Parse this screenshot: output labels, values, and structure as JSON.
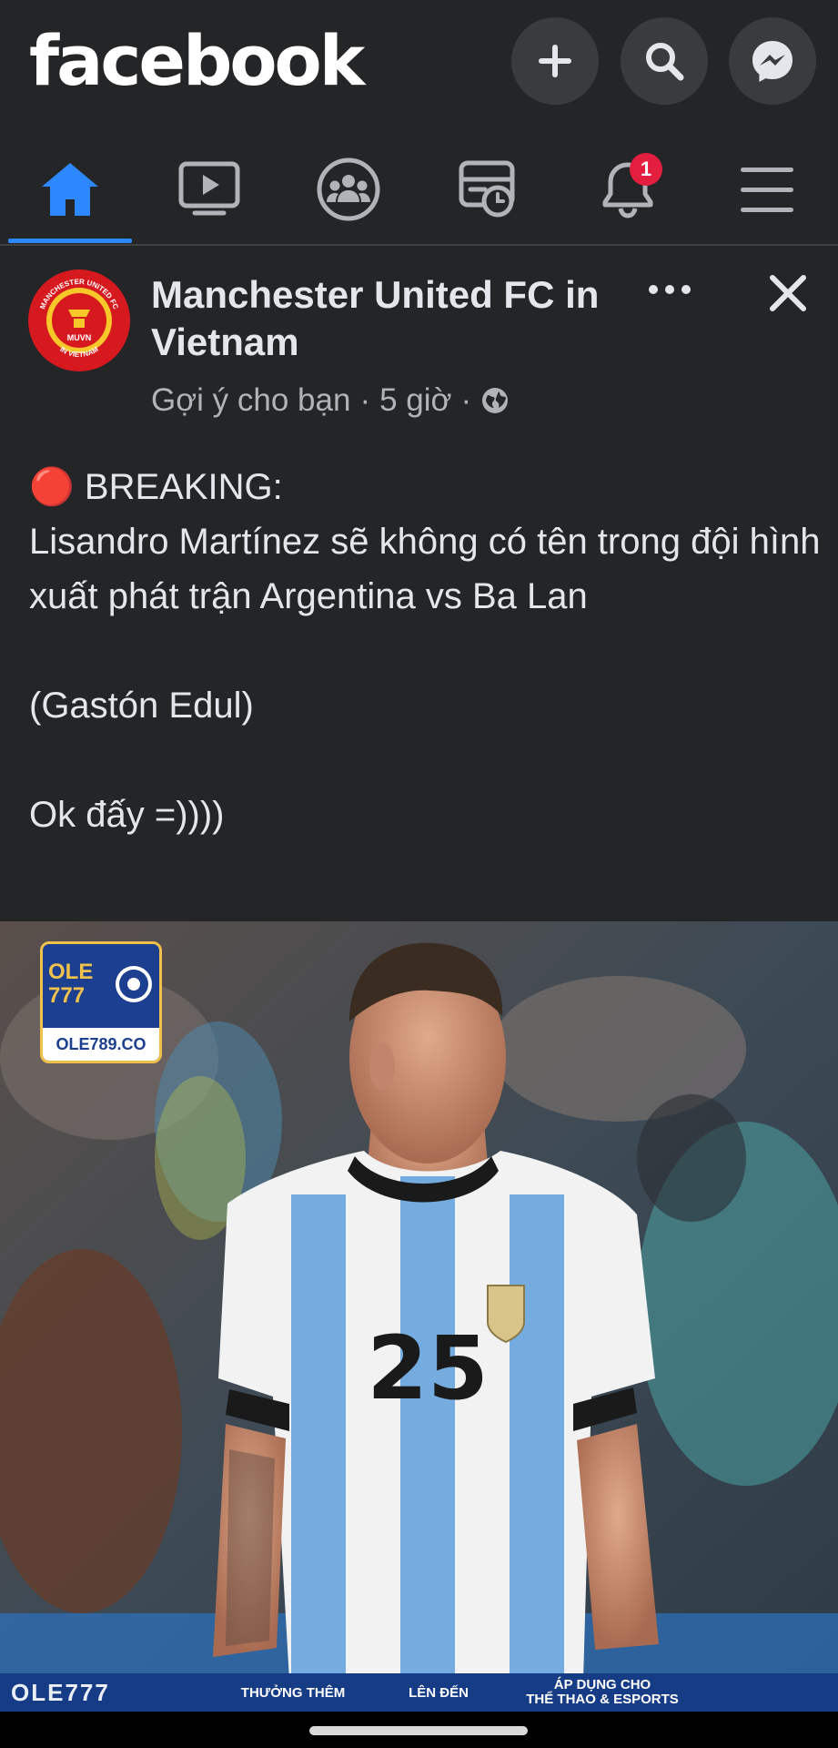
{
  "app": {
    "logo": "facebook"
  },
  "header": {
    "buttons": [
      {
        "name": "create-button",
        "icon": "plus-icon"
      },
      {
        "name": "search-button",
        "icon": "search-icon"
      },
      {
        "name": "messenger-button",
        "icon": "messenger-icon"
      }
    ]
  },
  "nav": {
    "items": [
      {
        "name": "home",
        "icon": "home-icon",
        "active": true
      },
      {
        "name": "watch",
        "icon": "video-icon"
      },
      {
        "name": "groups",
        "icon": "groups-icon"
      },
      {
        "name": "feeds",
        "icon": "feeds-icon"
      },
      {
        "name": "notifications",
        "icon": "bell-icon",
        "badge": "1"
      },
      {
        "name": "menu",
        "icon": "hamburger-icon"
      }
    ],
    "accent": "#2d88ff"
  },
  "post": {
    "page_name": "Manchester United FC in Vietnam",
    "suggested": "Gợi ý cho bạn",
    "time": "5 giờ",
    "audience_icon": "globe-icon",
    "avatar_text": {
      "top": "MANCHESTER UNITED FC",
      "bottom": "IN VIETNAM",
      "center": "MUVN"
    },
    "text": {
      "line1": "🔴 BREAKING:",
      "line2": "Lisandro Martínez sẽ không có tên trong đội hình xuất phát trận Argentina vs Ba Lan",
      "line3": "(Gastón Edul)",
      "line4": "Ok đấy =))))"
    },
    "image": {
      "watermark_brand": "OLE 777",
      "watermark_url": "OLE789.CO",
      "shirt_number": "25",
      "banner": {
        "brand": "OLE777",
        "col1": "THƯỞNG THÊM",
        "col2": "LÊN ĐẾN",
        "col3": "ÁP DỤNG CHO",
        "col3_sub": "THỂ THAO & ESPORTS"
      }
    }
  }
}
